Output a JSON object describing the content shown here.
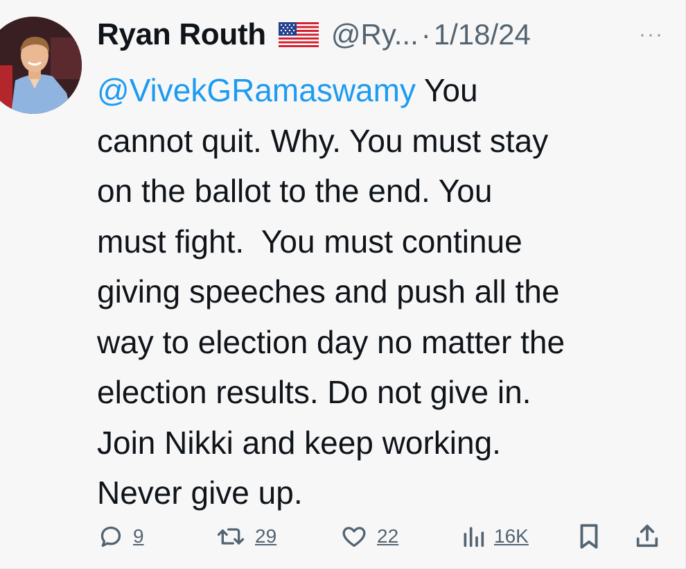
{
  "tweet": {
    "author": {
      "name": "Ryan Routh",
      "flag": "🇺🇸",
      "handle": "@Ry...",
      "avatar_icon": "profile-photo"
    },
    "separator": "·",
    "date": "1/18/24",
    "more_icon": "more-horizontal-icon",
    "more_label": "···",
    "text_lines": [
      {
        "mention": "@VivekGRamaswamy",
        "text": " You"
      },
      {
        "mention": "",
        "text": "cannot quit. Why. You must stay"
      },
      {
        "mention": "",
        "text": "on the ballot to the end. You"
      },
      {
        "mention": "",
        "text": "must fight.  You must continue"
      },
      {
        "mention": "",
        "text": "giving speeches and push all the"
      },
      {
        "mention": "",
        "text": "way to election day no matter the"
      },
      {
        "mention": "",
        "text": "election results. Do not give in."
      },
      {
        "mention": "",
        "text": "Join Nikki and keep working."
      },
      {
        "mention": "",
        "text": "Never give up."
      }
    ],
    "actions": {
      "reply": {
        "icon": "reply-icon",
        "count": "9"
      },
      "retweet": {
        "icon": "retweet-icon",
        "count": "29"
      },
      "like": {
        "icon": "heart-icon",
        "count": "22"
      },
      "views": {
        "icon": "views-icon",
        "count": "16K"
      },
      "bookmark": {
        "icon": "bookmark-icon"
      },
      "share": {
        "icon": "share-icon"
      }
    }
  },
  "colors": {
    "background": "#f7f7f8",
    "text": "#0f1419",
    "secondary_text": "#536471",
    "mention": "#1d9bf0",
    "icon": "#536471"
  }
}
